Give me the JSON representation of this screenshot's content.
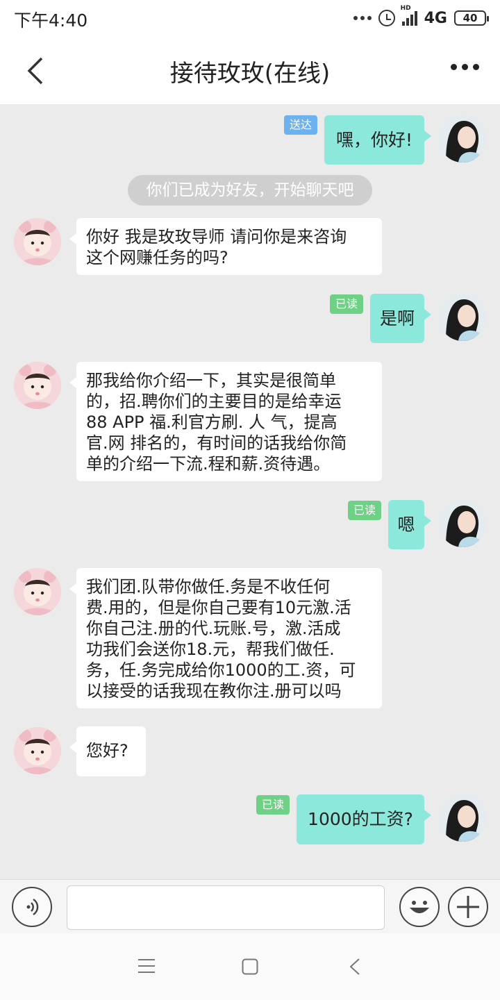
{
  "status_bar": {
    "time": "下午4:40",
    "network": "4G",
    "hd_label": "HD",
    "battery": "40",
    "icons": [
      "more-dots-icon",
      "alarm-icon",
      "signal-icon",
      "battery-icon"
    ]
  },
  "header": {
    "title": "接待玫玫(在线)",
    "back_icon": "back-arrow-icon",
    "more_icon": "more-icon"
  },
  "system_notice": "你们已成为好友，开始聊天吧",
  "messages": [
    {
      "side": "right",
      "text": "嘿，你好!",
      "status": "送达"
    },
    {
      "side": "left",
      "lines": [
        "你好 我是玫玫导师 请问你是来咨询",
        "这个网赚任务的吗?"
      ]
    },
    {
      "side": "right",
      "text": "是啊",
      "status": "已读"
    },
    {
      "side": "left",
      "lines": [
        "那我给你介绍一下，其实是很简单",
        "的，招.聘你们的主要目的是给幸运",
        "88 APP 福.利官方刷. 人 气，提高",
        "官.网 排名的，有时间的话我给你简",
        "单的介绍一下流.程和薪.资待遇。"
      ]
    },
    {
      "side": "right",
      "text": "嗯",
      "status": "已读"
    },
    {
      "side": "left",
      "lines": [
        "我们团.队带你做任.务是不收任何",
        "费.用的，但是你自己要有10元激.活",
        "你自己注.册的代.玩账.号，激.活成",
        "功我们会送你18.元，帮我们做任.",
        "务，任.务完成给你1000的工.资，可",
        "以接受的话我现在教你注.册可以吗"
      ]
    },
    {
      "side": "left",
      "text": "您好?"
    },
    {
      "side": "right",
      "text": "1000的工资?",
      "status": "已读"
    }
  ],
  "input_bar": {
    "voice_icon": "voice-icon",
    "emoji_icon": "emoji-icon",
    "plus_icon": "plus-icon",
    "placeholder": ""
  },
  "system_nav": [
    "menu-icon",
    "home-icon",
    "back-icon"
  ],
  "colors": {
    "chat_background": "#ebebeb",
    "outgoing_bubble": "#8de8dc",
    "incoming_bubble": "#ffffff",
    "delivered_tag": "#6db1ee",
    "read_tag": "#6fd186"
  }
}
